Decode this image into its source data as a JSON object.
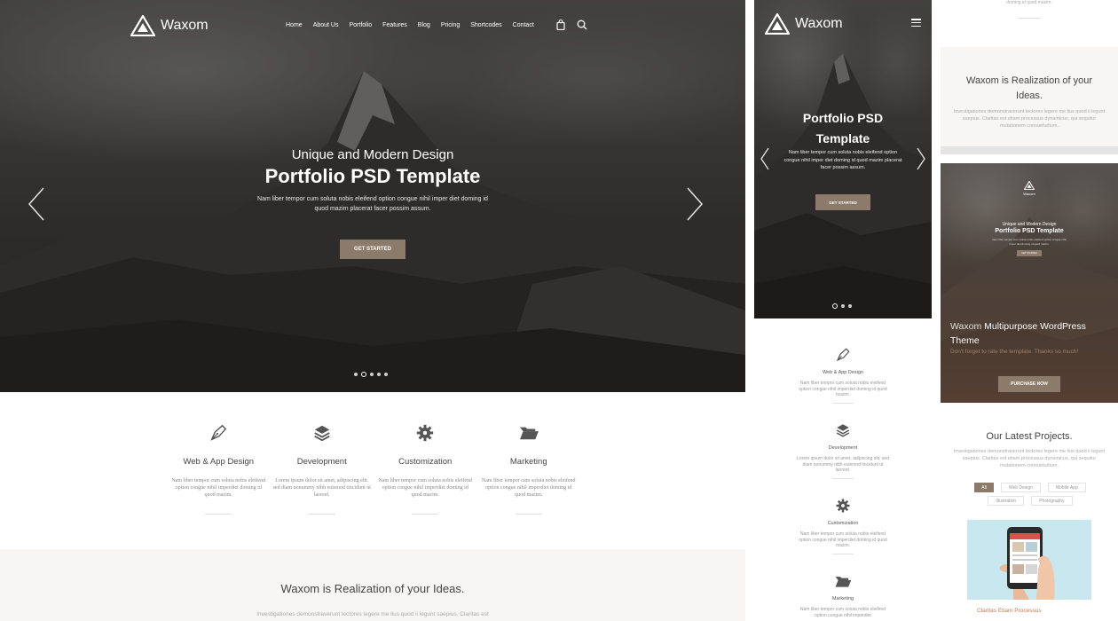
{
  "brand": {
    "name": "Waxom"
  },
  "nav": {
    "items": [
      "Home",
      "About Us",
      "Portfolio",
      "Features",
      "Blog",
      "Pricing",
      "Shortcodes",
      "Contact"
    ],
    "icons": [
      "shopping-bag-icon",
      "search-icon"
    ]
  },
  "hero": {
    "subtitle": "Unique and Modern Design",
    "title": "Portfolio PSD Template",
    "description": "Nam liber tempor cum soluta nobis eleifend option congue nihil imper diet doming id quod mazim placerat facer possim assum.",
    "cta": "GET STARTED",
    "slides": 5,
    "active_slide": 2
  },
  "services": [
    {
      "icon": "pen-nib-icon",
      "title": "Web & App Design",
      "desc": "Nam liber tempor cum soluta nobis eleifend option congue nihil imperdiet doming id quod mazim."
    },
    {
      "icon": "layers-icon",
      "title": "Development",
      "desc": "Lorem ipsum dolor sit amet, adipiscing elit. sed diam nonummy nibh euismod tincidunt ut laoreet."
    },
    {
      "icon": "gear-icon",
      "title": "Customization",
      "desc": "Nam liber tempor cum soluta nobis eleifend option congue nihil imperdiet doming id quod mazim."
    },
    {
      "icon": "folder-icon",
      "title": "Marketing",
      "desc": "Nam liber tempor cum soluta nobis eleifend option congue nihil imperdiet doming id quod mazim."
    }
  ],
  "realization": {
    "title": "Waxom is Realization of your Ideas.",
    "desc": "Investigationes demonstraverunt lectores legere me lius quod ii legunt saepius. Claritas est"
  },
  "mobile": {
    "title_line1": "Portfolio PSD",
    "title_line2": "Template",
    "description": "Nam liber tempor cum soluta nobis eleifend option congue nihil imper diet doming id quod mazim placerat facer possim assum.",
    "cta": "GET STARTED",
    "slides": 3,
    "active_slide": 1,
    "services": [
      {
        "icon": "pen-nib-icon",
        "title": "Web & App Design",
        "desc": "Nam liber tempor cum soluta nobis eleifend option congue nihil imperdiet doming id quod mazim."
      },
      {
        "icon": "layers-icon",
        "title": "Development",
        "desc": "Lorem ipsum dolor sit amet, adipiscing elit, sed diam nonummy nibh euismod tincidunt ut laoreet."
      },
      {
        "icon": "gear-icon",
        "title": "Customization",
        "desc": "Nam liber tempor cum soluta nobis eleifend option congue nihil imperdiet doming id quod mazim."
      },
      {
        "icon": "folder-icon",
        "title": "Marketing",
        "desc": "Nam liber tempor cum soluta nobis eleifend option congue nihil imperdiet"
      }
    ]
  },
  "right_column": {
    "top_text": "doming id quod mazim.",
    "realization_title": "Waxom is Realization of your Ideas.",
    "realization_desc": "Investigationes demonstraverunt lectores legere me lius quod ii legunt saepius. Claritas est etiam processus dynamicus, qui sequitur mutationem consuetudium.",
    "promo": {
      "logo_text": "Waxom",
      "subtitle": "Unique and Modern Design",
      "title": "Portfolio PSD Template",
      "desc": "Nam liber tempor cum soluta nobis eleifend option congue nihil imper diet doming id quod mazim.",
      "button": "GET STARTED",
      "headline_prefix": "Waxom ",
      "headline_rest": "Multipurpose WordPress Theme",
      "small_text": "Don't forget to rate the template. Thanks so much!",
      "purchase": "PURCHASE NOW"
    },
    "latest_title": "Our Latest Projects.",
    "latest_desc": "Investigationes demonstraverunt lectores legere me lius quod ii legunt saepius. Claritas est etiam processus dynamicus, qui sequitur mutationem consuetudium.",
    "filters": [
      "All",
      "Web Design",
      "Mobile App",
      "Illustration",
      "Photography"
    ],
    "active_filter": "All",
    "project_caption": "Claritas Etiam Processus"
  }
}
